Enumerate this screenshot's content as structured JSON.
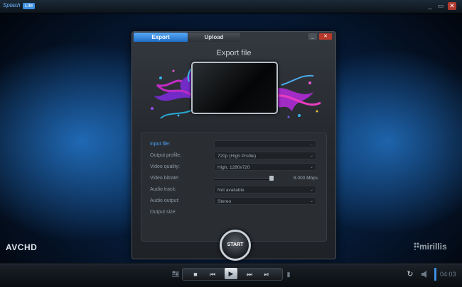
{
  "app": {
    "logo_text": "Splash",
    "badge": "Lite"
  },
  "window_controls": {
    "minimize": "_",
    "maximize": "▭",
    "close": "✕"
  },
  "brand": {
    "avchd": "AVCHD",
    "mirillis": "mirillis"
  },
  "dialog": {
    "tabs": [
      {
        "label": "Export"
      },
      {
        "label": "Upload"
      }
    ],
    "minimize": "_",
    "close": "✕",
    "title": "Export file",
    "fields": {
      "input_file": {
        "label": "Input file:",
        "value": "",
        "action": "..."
      },
      "output_profile": {
        "label": "Output profile:",
        "value": "720p (High Profile)"
      },
      "video_quality": {
        "label": "Video quality:",
        "value": "High, 1280x720"
      },
      "video_bitrate": {
        "label": "Video bitrate:",
        "value": "8.000 Mbps",
        "level": 0.95
      },
      "audio_track": {
        "label": "Audio track:",
        "value": "Not available"
      },
      "audio_output": {
        "label": "Audio output:",
        "value": "Stereo"
      },
      "output_size": {
        "label": "Output size:",
        "value": ""
      }
    },
    "start_label": "START"
  },
  "player": {
    "time": "04:03",
    "icons": [
      "settings-icon",
      "stop-icon",
      "previous-icon",
      "play-icon",
      "next-icon",
      "step-icon",
      "repeat-icon",
      "volume-icon"
    ]
  }
}
